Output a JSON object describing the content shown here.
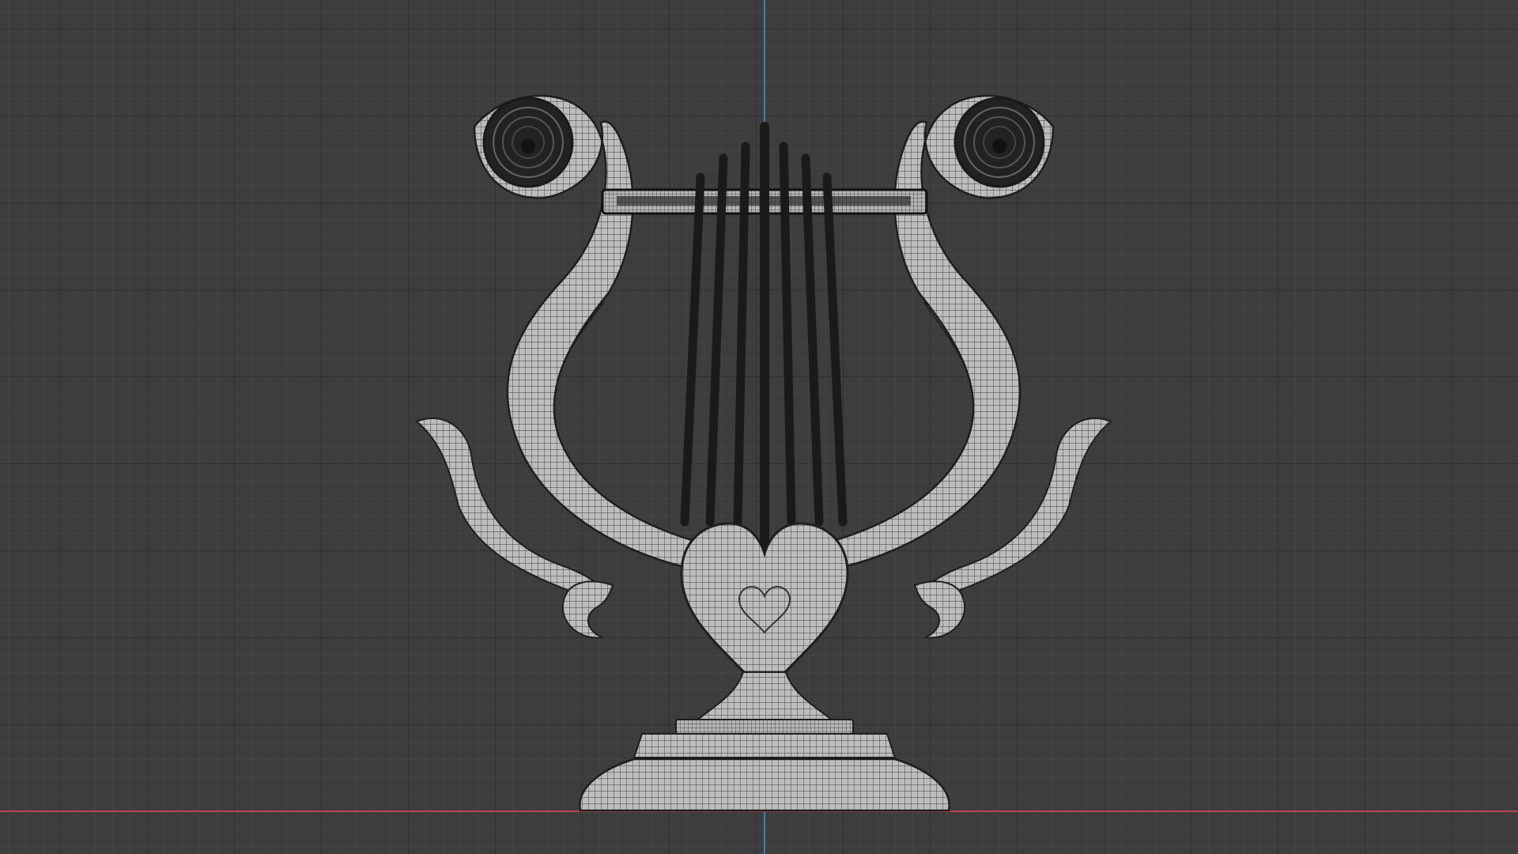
{
  "viewport": {
    "view": "front-orthographic",
    "shading": "wireframe-overlay",
    "grid": true,
    "background_color": "#3d3d3d",
    "axis_colors": {
      "x": "#b64550",
      "z": "#3f7fbf"
    }
  },
  "object": {
    "name": "",
    "subject": "lyre",
    "mesh_fill_color": "#bdbdbd",
    "wire_color": "#2a2a2a",
    "string_color": "#1a1a1a",
    "string_count": 7
  }
}
